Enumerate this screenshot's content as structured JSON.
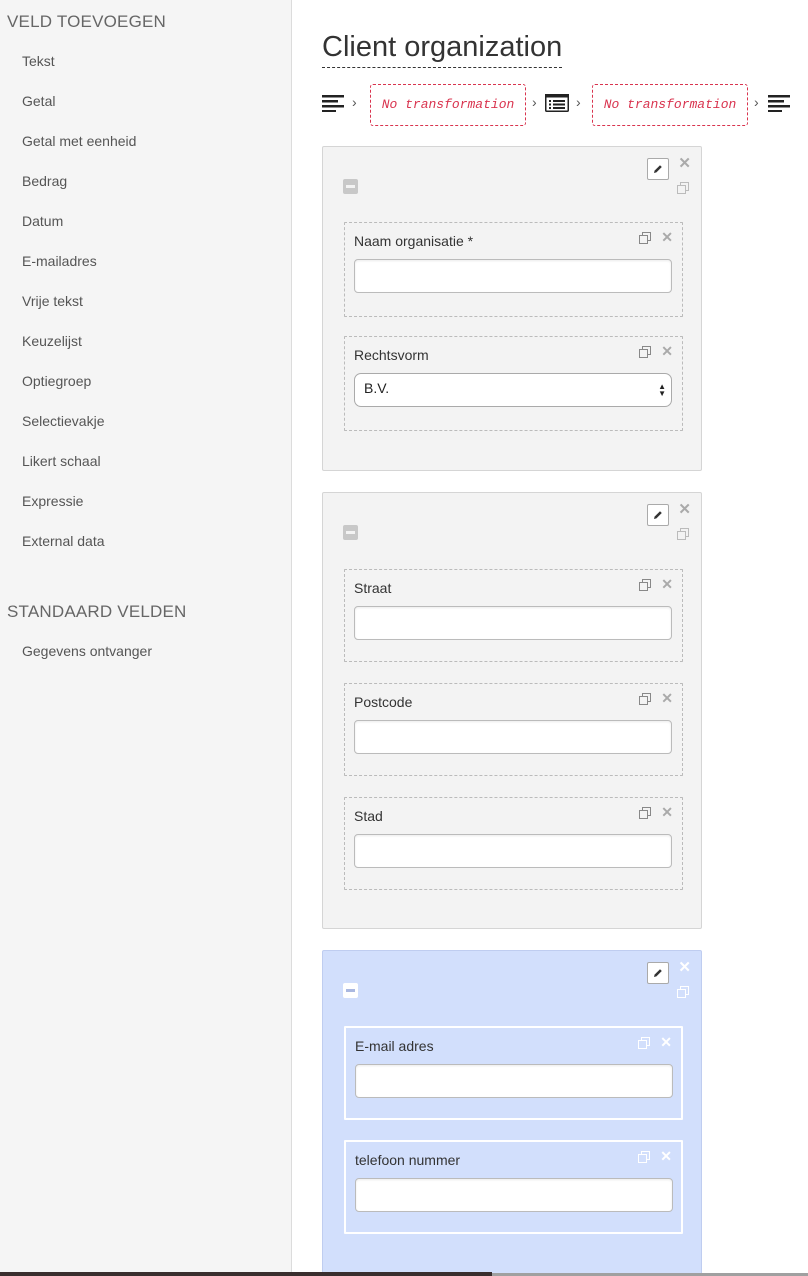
{
  "sidebar": {
    "section1_title": "VELD TOEVOEGEN",
    "items": [
      "Tekst",
      "Getal",
      "Getal met eenheid",
      "Bedrag",
      "Datum",
      "E-mailadres",
      "Vrije tekst",
      "Keuzelijst",
      "Optiegroep",
      "Selectievakje",
      "Likert schaal",
      "Expressie",
      "External data"
    ],
    "section2_title": "STANDAARD VELDEN",
    "standard_items": [
      "Gegevens ontvanger"
    ]
  },
  "main": {
    "title": "Client organization",
    "pipeline": {
      "steps": [
        {
          "icon": "align-left-icon"
        },
        {
          "label": "No transformation"
        },
        {
          "icon": "list-table-icon"
        },
        {
          "label": "No transformation"
        },
        {
          "icon": "align-left-icon"
        }
      ],
      "transform_label_1": "No transformation",
      "transform_label_2": "No transformation"
    },
    "panels": [
      {
        "selected": false,
        "fields": [
          {
            "label": "Naam organisatie *",
            "type": "text",
            "value": ""
          },
          {
            "label": "Rechtsvorm",
            "type": "select",
            "value": "B.V."
          }
        ]
      },
      {
        "selected": false,
        "fields": [
          {
            "label": "Straat",
            "type": "text",
            "value": ""
          },
          {
            "label": "Postcode",
            "type": "text",
            "value": ""
          },
          {
            "label": "Stad",
            "type": "text",
            "value": ""
          }
        ]
      },
      {
        "selected": true,
        "fields": [
          {
            "label": "E-mail adres",
            "type": "text",
            "value": ""
          },
          {
            "label": "telefoon nummer",
            "type": "text",
            "value": ""
          }
        ]
      }
    ]
  },
  "colors": {
    "accent_dashed": "#d9344f",
    "selected_panel": "#d2dffc",
    "panel_bg": "#f3f3f3",
    "sidebar_bg": "#f5f5f5"
  }
}
